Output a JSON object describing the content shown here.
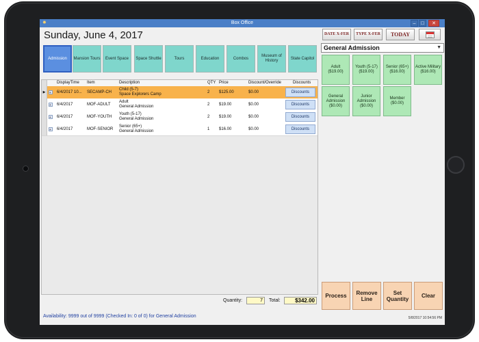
{
  "window": {
    "title": "Box Office",
    "minimize": "–",
    "maximize": "□",
    "close": "✕"
  },
  "header": {
    "date": "Sunday, June 4, 2017",
    "date_xfer": "DATE X-FER",
    "type_xfer": "TYPE X-FER",
    "today": "TODAY"
  },
  "categories": [
    "Admission",
    "Mansion Tours",
    "Event Space",
    "Space Shuttle",
    "Tours",
    "Education",
    "Combos",
    "Museum of History",
    "State Capitol"
  ],
  "ticket_type": "General Admission",
  "tickets": [
    {
      "name": "Adult",
      "price": "($19.00)"
    },
    {
      "name": "Youth (5-17)",
      "price": "($19.00)"
    },
    {
      "name": "Senior (65+)",
      "price": "($16.00)"
    },
    {
      "name": "Active Military",
      "price": "($16.00)"
    },
    {
      "name": "General Admission",
      "price": "($0.00)"
    },
    {
      "name": "Junior Admission",
      "price": "($0.00)"
    },
    {
      "name": "Member",
      "price": "($0.00)"
    }
  ],
  "grid": {
    "columns": [
      "DisplayTime",
      "Item",
      "Description",
      "QTY",
      "Price",
      "Discount/Override",
      "Discounts"
    ],
    "rows": [
      {
        "time": "6/4/2017 10...",
        "item": "SECAMP-CH",
        "desc1": "Child (5-7)",
        "desc2": "Space Explorers Camp",
        "qty": "2",
        "price": "$125.00",
        "discount": "$0.00",
        "disc_btn": "Discounts"
      },
      {
        "time": "6/4/2017",
        "item": "MOF-ADULT",
        "desc1": "Adult",
        "desc2": "General Admission",
        "qty": "2",
        "price": "$19.00",
        "discount": "$0.00",
        "disc_btn": "Discounts"
      },
      {
        "time": "6/4/2017",
        "item": "MOF-YOUTH",
        "desc1": "Youth (5-17)",
        "desc2": "General Admission",
        "qty": "2",
        "price": "$19.00",
        "discount": "$0.00",
        "disc_btn": "Discounts"
      },
      {
        "time": "6/4/2017",
        "item": "MOF-SENIOR",
        "desc1": "Senior (65+)",
        "desc2": "General Admission",
        "qty": "1",
        "price": "$16.00",
        "discount": "$0.00",
        "disc_btn": "Discounts"
      }
    ]
  },
  "totals": {
    "quantity_label": "Quantity:",
    "quantity": "7",
    "total_label": "Total:",
    "total": "$342.00"
  },
  "actions": [
    "Process",
    "Remove Line",
    "Set Quantity",
    "Clear"
  ],
  "status": {
    "availability": "Availability: 9999 out of 9999 (Checked In: 0 of 0) for General Admission",
    "clock": "5/8/2017 10:54:56 PM"
  }
}
